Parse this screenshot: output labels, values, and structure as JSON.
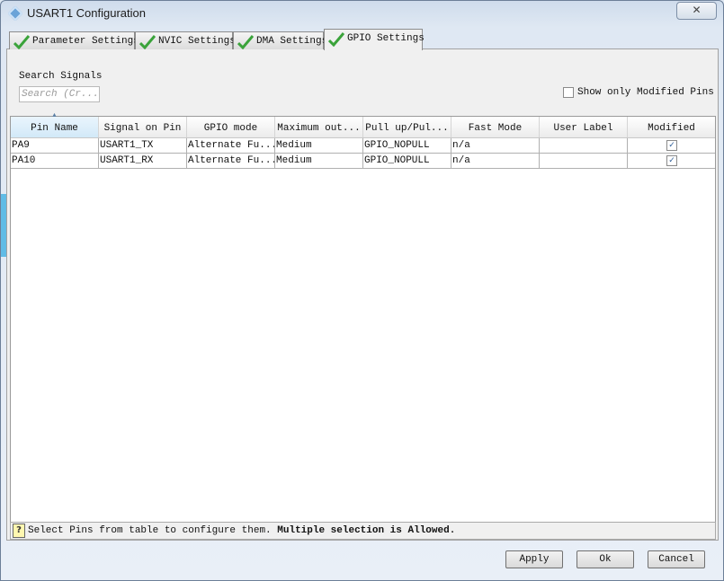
{
  "window": {
    "title": "USART1 Configuration",
    "close_glyph": "✕",
    "icon": "app-icon"
  },
  "tabs": [
    {
      "label": "Parameter Settings",
      "checked": true,
      "active": false
    },
    {
      "label": "NVIC Settings",
      "checked": true,
      "active": false
    },
    {
      "label": "DMA Settings",
      "checked": true,
      "active": false
    },
    {
      "label": "GPIO Settings",
      "checked": true,
      "active": true
    }
  ],
  "search": {
    "label": "Search Signals",
    "placeholder": "Search (Cr...",
    "value": ""
  },
  "filter": {
    "show_modified_label": "Show only Modified Pins",
    "checked": false
  },
  "table": {
    "columns": [
      "Pin Name",
      "Signal on Pin",
      "GPIO mode",
      "Maximum out...",
      "Pull up/Pul...",
      "Fast Mode",
      "User Label",
      "Modified"
    ],
    "sorted_column": "Pin Name",
    "rows": [
      {
        "pin": "PA9",
        "signal": "USART1_TX",
        "mode": "Alternate Fu...",
        "speed": "Medium",
        "pull": "GPIO_NOPULL",
        "fast": "n/a",
        "user_label": "",
        "modified": true
      },
      {
        "pin": "PA10",
        "signal": "USART1_RX",
        "mode": "Alternate Fu...",
        "speed": "Medium",
        "pull": "GPIO_NOPULL",
        "fast": "n/a",
        "user_label": "",
        "modified": true
      }
    ]
  },
  "status": {
    "icon": "help-icon",
    "icon_glyph": "?",
    "text": "Select Pins from table to configure them.",
    "bold_text": "Multiple selection is Allowed."
  },
  "buttons": {
    "apply": "Apply",
    "ok": "Ok",
    "cancel": "Cancel"
  },
  "colors": {
    "check_green": "#3aa33a",
    "title_bar": "#cfdcec"
  }
}
